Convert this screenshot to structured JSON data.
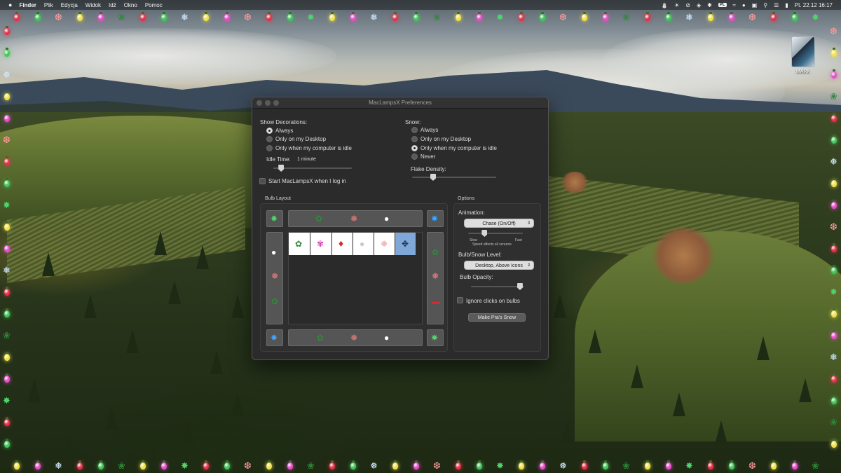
{
  "menubar": {
    "apple_icon": "apple-icon",
    "app_name": "Finder",
    "items": [
      "Plik",
      "Edycja",
      "Widok",
      "Idź",
      "Okno",
      "Pomoc"
    ],
    "status_icons": [
      "lamp-icon",
      "sun-icon",
      "blocked-icon",
      "shield-icon",
      "bluetooth-icon"
    ],
    "input_source": "PL",
    "clock": "Pt. 22.12  16:17"
  },
  "desktop": {
    "drive_label": "MARK"
  },
  "window": {
    "title": "MacLampsX Preferences",
    "show_decorations": {
      "label": "Show Decorations:",
      "options": [
        "Always",
        "Only on my Desktop",
        "Only when my computer is idle"
      ],
      "selected": "Always"
    },
    "snow": {
      "label": "Snow:",
      "options": [
        "Always",
        "Only on my Desktop",
        "Only when my computer is idle",
        "Never"
      ],
      "selected": "Only when my computer is idle"
    },
    "idle_time": {
      "label": "Idle Time:",
      "value": "1 minute",
      "level": 0.1
    },
    "flake_density": {
      "label": "Flake Density:",
      "level": 0.25
    },
    "start_at_login": {
      "label": "Start MacLampsX when I log in",
      "checked": false
    },
    "bulb_layout": {
      "label": "Bulb Layout",
      "palette": [
        "holly",
        "pink-flower",
        "red-chili-bulb",
        "white-globe-bulb",
        "snowflake-outline",
        "move-cursor"
      ]
    },
    "options": {
      "label": "Options",
      "animation_label": "Animation:",
      "animation_value": "Chase (On/Off)",
      "speed_slow": "Slow",
      "speed_fast": "Fast",
      "speed_note": "Speed affects all screens",
      "speed_level": 0.3,
      "level_label": "Bulb/Snow Level:",
      "level_value": "Desktop, Above Icons",
      "opacity_label": "Bulb Opacity:",
      "opacity_level": 0.92,
      "ignore_clicks": {
        "label": "Ignore clicks on bulbs",
        "checked": false
      },
      "snow_button": "Make Pra's Snow"
    }
  },
  "colors": {
    "window_bg": "#2b2b2b",
    "bulb_red": "#e2334a",
    "bulb_green": "#43c65a",
    "bulb_blue": "#3aa4ff",
    "bulb_yellow": "#f2e24a",
    "bulb_pink": "#e64fc9",
    "bulb_white": "#f0f0f0"
  }
}
